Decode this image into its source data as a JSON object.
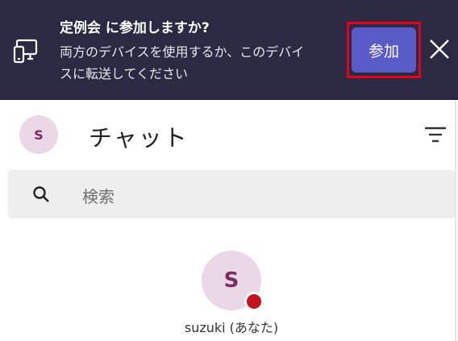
{
  "banner": {
    "title": "定例会 に参加しますか?",
    "message_line1": "両方のデバイスを使用するか、このデバイ",
    "message_line2": "スに転送してください",
    "join_label": "参加",
    "background_color": "#2b2a42",
    "button_color": "#5a5bc7",
    "icons": {
      "device": "device-transfer-icon",
      "close": "close-icon"
    }
  },
  "header": {
    "avatar_initial": "S",
    "title": "チャット",
    "icons": {
      "filter": "filter-icon"
    }
  },
  "search": {
    "placeholder": "検索",
    "icon": "search-icon"
  },
  "profile": {
    "avatar_initial": "S",
    "name": "suzuki (あなた)",
    "status_color": "#c4131f"
  },
  "colors": {
    "highlight": "#e4001b",
    "avatar_bg": "#ead8e6",
    "avatar_fg": "#7a2b60"
  }
}
